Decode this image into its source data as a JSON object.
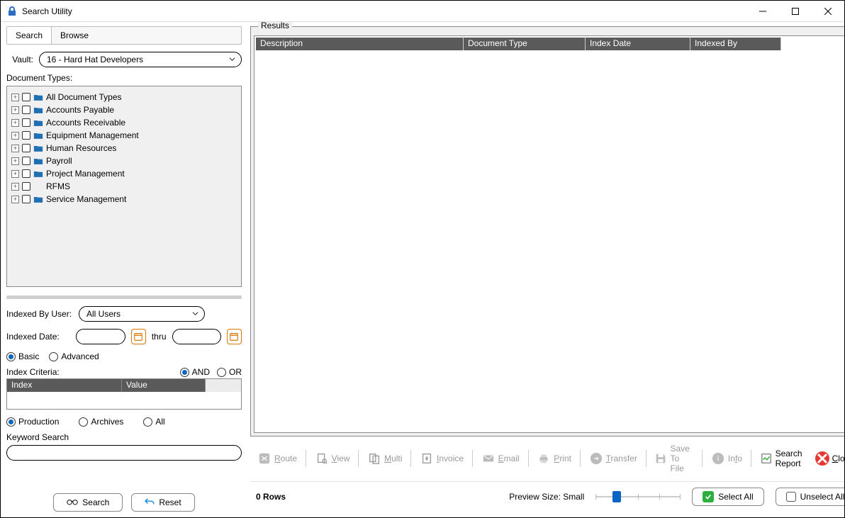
{
  "window": {
    "title": "Search Utility"
  },
  "tabs": {
    "search": "Search",
    "browse": "Browse"
  },
  "vault": {
    "label": "Vault:",
    "value": "16 - Hard Hat Developers"
  },
  "doc_types": {
    "label": "Document Types:",
    "items": [
      {
        "label": "All Document Types",
        "has_icon": true
      },
      {
        "label": "Accounts Payable",
        "has_icon": true
      },
      {
        "label": "Accounts Receivable",
        "has_icon": true
      },
      {
        "label": "Equipment Management",
        "has_icon": true
      },
      {
        "label": "Human Resources",
        "has_icon": true
      },
      {
        "label": "Payroll",
        "has_icon": true
      },
      {
        "label": "Project Management",
        "has_icon": true
      },
      {
        "label": "RFMS",
        "has_icon": false
      },
      {
        "label": "Service Management",
        "has_icon": true
      }
    ]
  },
  "indexed_by": {
    "label": "Indexed By User:",
    "value": "All Users"
  },
  "indexed_date": {
    "label": "Indexed Date:",
    "thru": "thru"
  },
  "mode": {
    "basic": "Basic",
    "advanced": "Advanced"
  },
  "criteria": {
    "label": "Index Criteria:",
    "and": "AND",
    "or": "OR",
    "headers": {
      "index": "Index",
      "value": "Value"
    }
  },
  "scope": {
    "production": "Production",
    "archives": "Archives",
    "all": "All"
  },
  "keyword": {
    "label": "Keyword Search"
  },
  "buttons": {
    "search": "Search",
    "reset": "Reset"
  },
  "results": {
    "label": "Results",
    "headers": {
      "description": "Description",
      "doc_type": "Document Type",
      "index_date": "Index Date",
      "indexed_by": "Indexed By"
    }
  },
  "toolbar": {
    "route": "Route",
    "view": "View",
    "multi": "Multi",
    "invoice": "Invoice",
    "email": "Email",
    "print": "Print",
    "transfer": "Transfer",
    "save": "Save To File",
    "info": "Info",
    "report": "Search Report",
    "close": "Close"
  },
  "status": {
    "rows": "0 Rows",
    "preview_label": "Preview Size: Small",
    "select_all": "Select All",
    "unselect_all": "Unselect All"
  }
}
